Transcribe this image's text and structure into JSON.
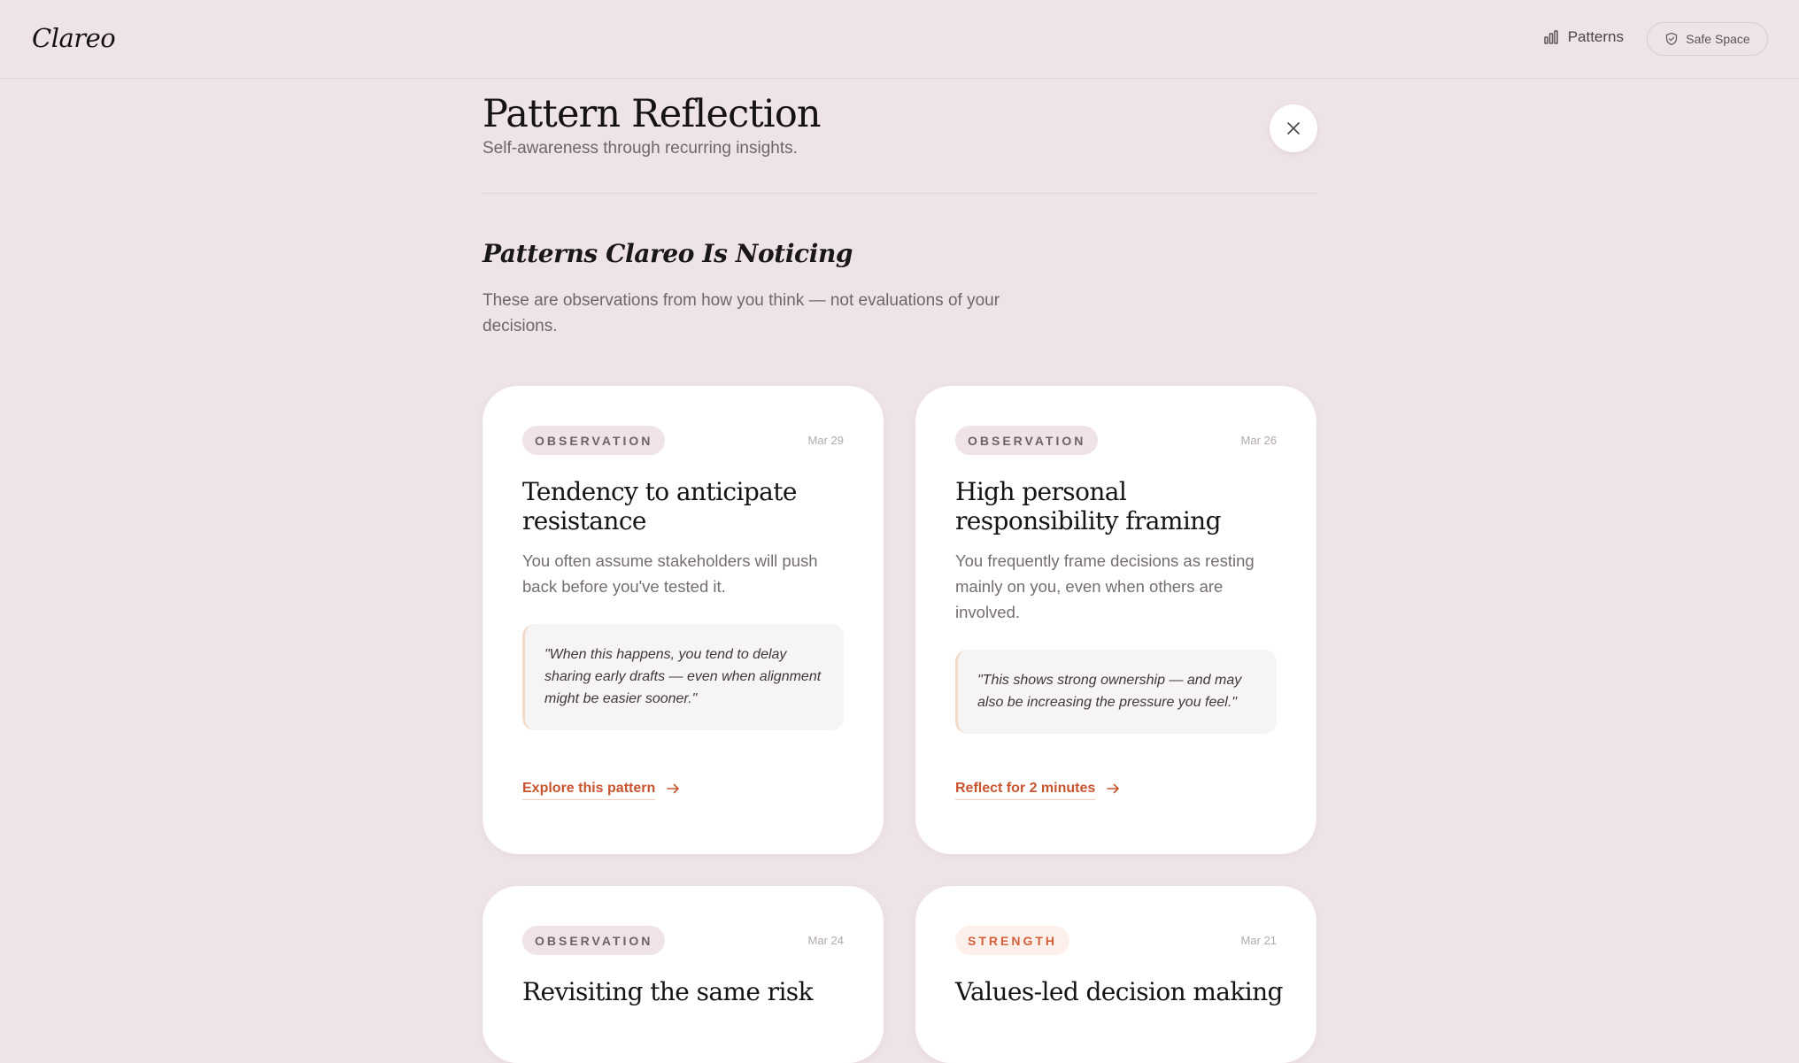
{
  "app": {
    "logo": "Clareo"
  },
  "nav": {
    "patterns_label": "Patterns",
    "safe_space_label": "Safe Space"
  },
  "header": {
    "title": "Pattern Reflection",
    "subtitle": "Self-awareness through recurring insights."
  },
  "section": {
    "title": "Patterns Clareo Is Noticing",
    "description": "These are observations from how you think — not evaluations of your decisions."
  },
  "cards": [
    {
      "tag": "OBSERVATION",
      "date": "Mar 29",
      "title": "Tendency to anticipate resistance",
      "description": "You often assume stakeholders will push back before you've tested it.",
      "quote": "\"When this happens, you tend to delay sharing early drafts — even when alignment might be easier sooner.\"",
      "cta": "Explore this pattern"
    },
    {
      "tag": "OBSERVATION",
      "date": "Mar 26",
      "title": "High personal responsibility framing",
      "description": "You frequently frame decisions as resting mainly on you, even when others are involved.",
      "quote": "\"This shows strong ownership — and may also be increasing the pressure you feel.\"",
      "cta": "Reflect for 2 minutes"
    },
    {
      "tag": "OBSERVATION",
      "date": "Mar 24",
      "title": "Revisiting the same risk"
    },
    {
      "tag": "STRENGTH",
      "date": "Mar 21",
      "title": "Values-led decision making"
    }
  ],
  "colors": {
    "background": "#eee3e8",
    "card": "#ffffff",
    "accent": "#c9542f",
    "strength_tag_bg": "#fdf0ea"
  },
  "icons": {
    "patterns": "bar-chart-icon",
    "safe_space": "shield-check-icon",
    "close": "close-icon",
    "cta": "arrow-right-icon"
  }
}
